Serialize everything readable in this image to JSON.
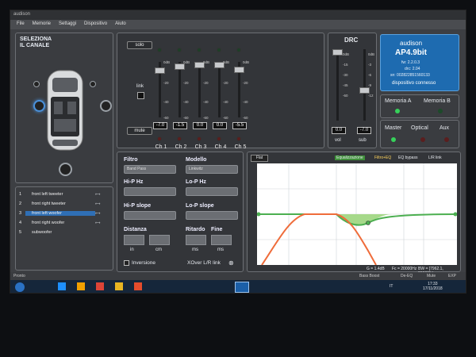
{
  "window": {
    "title": "audison"
  },
  "menu": [
    "File",
    "Memorie",
    "Settaggi",
    "Dispositivo",
    "Aiuto"
  ],
  "left": {
    "title_line1": "SELEZIONA",
    "title_line2": "IL CANALE",
    "channels": [
      {
        "num": "1",
        "name": "front left tweeter"
      },
      {
        "num": "2",
        "name": "front right tweeter"
      },
      {
        "num": "3",
        "name": "front left woofer"
      },
      {
        "num": "4",
        "name": "front right woofer"
      },
      {
        "num": "5",
        "name": "subwoofer"
      }
    ]
  },
  "mixer": {
    "solo_label": "solo",
    "mute_label": "mute",
    "link_label": "link",
    "scale": [
      "0dB",
      "-20",
      "-40",
      "-60"
    ],
    "channels": [
      {
        "label": "Ch 1",
        "value": "-7.0",
        "level": 0.88
      },
      {
        "label": "Ch 2",
        "value": "-1.5",
        "level": 0.97
      },
      {
        "label": "Ch 3",
        "value": "0.0",
        "level": 1.0
      },
      {
        "label": "Ch 4",
        "value": "0.0",
        "level": 1.0
      },
      {
        "label": "Ch 5",
        "value": "-5.5",
        "level": 0.91
      }
    ]
  },
  "drc": {
    "title": "DRC",
    "vol_label": "vol",
    "sub_label": "sub",
    "vol_value": "0.0",
    "sub_value": "-7.0",
    "vol_scale": [
      "0dB",
      "-15",
      "-30",
      "-45",
      "-60"
    ],
    "sub_scale": [
      "0dB",
      "-3",
      "-6",
      "-9",
      "-12"
    ]
  },
  "device": {
    "brand": "audison",
    "model": "AP4.9bit",
    "fw": "fw: 2.2.0.3",
    "drc": "drc: 2.04",
    "sn": "sn: 002822851560133",
    "status": "dispositivo connesso"
  },
  "memory": {
    "a": "Memoria A",
    "b": "Memoria B"
  },
  "sources": {
    "master": "Master",
    "optical": "Optical",
    "aux": "Aux"
  },
  "settings": {
    "filtro": "Filtro",
    "filtro_value": "Band Pass",
    "modello": "Modello",
    "modello_value": "Linkwitz",
    "hipass_hz": "Hi-P Hz",
    "lopass_hz": "Lo-P Hz",
    "hipass_slope": "Hi-P slope",
    "lopass_slope": "Lo-P slope",
    "distanza": "Distanza",
    "ritardo": "Ritardo",
    "fine": "Fine",
    "in": "in",
    "cm": "cm",
    "ms": "ms",
    "inversione": "Inversione",
    "xover_link": "XOver L/R link"
  },
  "graph": {
    "tab": "Flat",
    "equalization": "Equalizzazione",
    "filter_eq": "Filtro+EQ",
    "eq_bypass": "EQ bypass",
    "lr_link": "L/R link",
    "footer_g": "G = 1.4dB",
    "footer_fc": "Fc = 20000Hz",
    "footer_bw": "BW = [7962.1, 20000]Hz",
    "x_ticks": [
      "50Hz",
      "500Hz",
      "1kHz",
      "5kHz",
      "10kHz"
    ],
    "y_ticks": [
      "20dB",
      "0",
      "-20",
      "-40"
    ]
  },
  "statusbar": {
    "left": "Pronto",
    "bass_boost": "Bass Boost",
    "de_eq": "De-EQ",
    "mute": "Mute",
    "exp": "EXP"
  },
  "taskbar": {
    "time": "17:33",
    "date": "17/11/2018",
    "lang": "IT"
  }
}
